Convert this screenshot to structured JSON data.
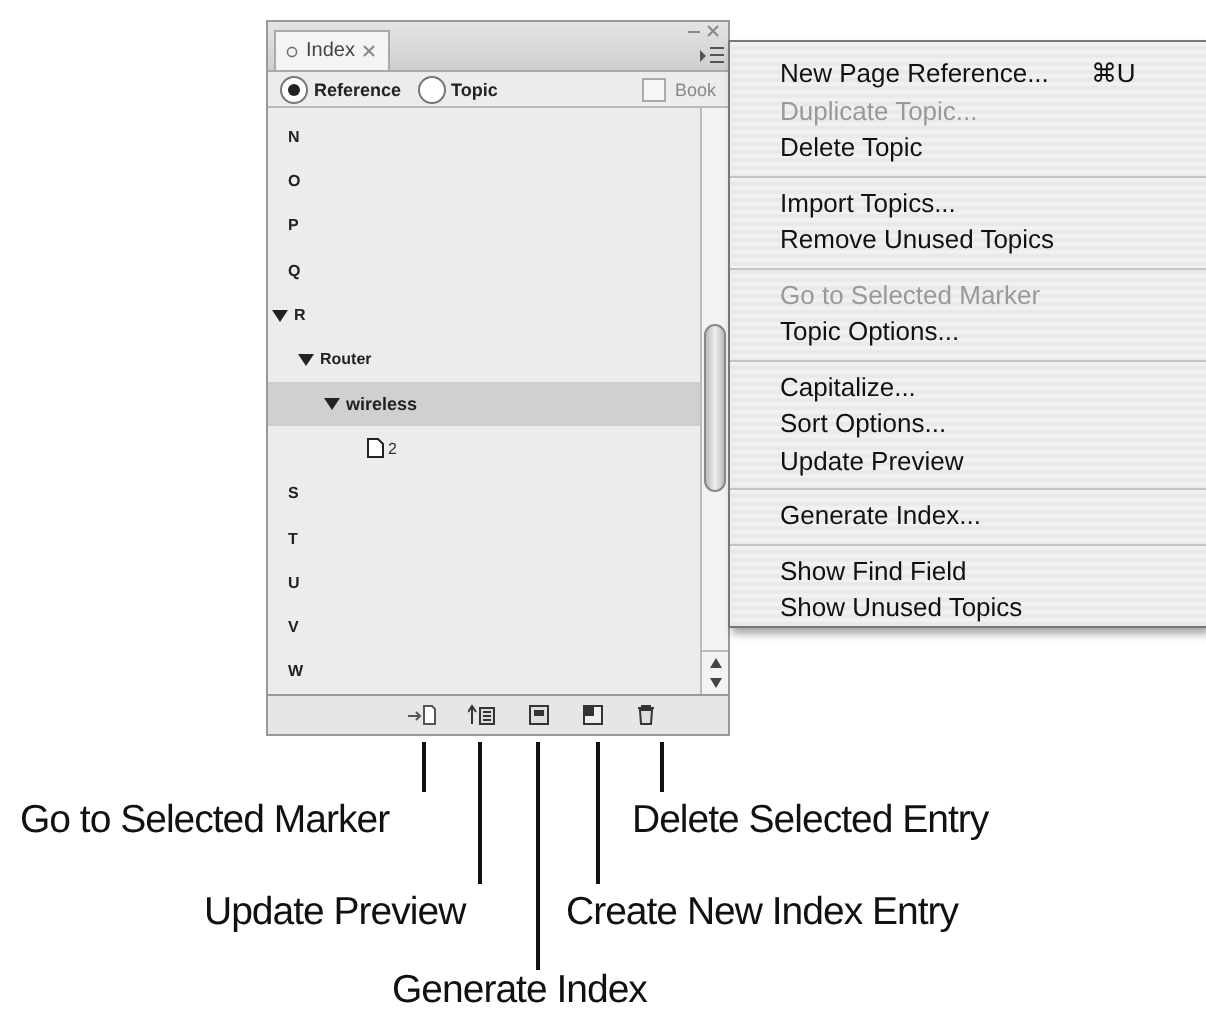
{
  "panel": {
    "tab": {
      "label": "Index"
    },
    "radios": [
      {
        "label": "Reference",
        "selected": true
      },
      {
        "label": "Topic",
        "selected": false
      }
    ],
    "book": {
      "label": "Book",
      "checked": false
    },
    "tree": [
      {
        "label": "N",
        "kind": "topic",
        "selected": false
      },
      {
        "label": "O",
        "kind": "topic",
        "selected": false
      },
      {
        "label": "P",
        "kind": "topic",
        "selected": false
      },
      {
        "label": "Q",
        "kind": "topic",
        "selected": false
      },
      {
        "label": "R",
        "kind": "topic",
        "selected": false,
        "expanded": true,
        "children": [
          {
            "label": "Router",
            "kind": "topic",
            "selected": false,
            "expanded": true,
            "children": [
              {
                "label": "wireless",
                "kind": "topic",
                "selected": true,
                "expanded": true,
                "children": [
                  {
                    "label": "2",
                    "kind": "page",
                    "selected": false
                  }
                ]
              }
            ]
          }
        ]
      },
      {
        "label": "S",
        "kind": "topic",
        "selected": false
      },
      {
        "label": "T",
        "kind": "topic",
        "selected": false
      },
      {
        "label": "U",
        "kind": "topic",
        "selected": false
      },
      {
        "label": "V",
        "kind": "topic",
        "selected": false
      },
      {
        "label": "W",
        "kind": "topic",
        "selected": false
      }
    ]
  },
  "menu": [
    [
      {
        "label": "New Page Reference...",
        "shortcut": "⌘U",
        "disabled": false
      },
      {
        "label": "Duplicate Topic...",
        "disabled": true
      },
      {
        "label": "Delete Topic",
        "disabled": false
      }
    ],
    [
      {
        "label": "Import Topics...",
        "disabled": false
      },
      {
        "label": "Remove Unused Topics",
        "disabled": false
      }
    ],
    [
      {
        "label": "Go to Selected Marker",
        "disabled": true
      },
      {
        "label": "Topic Options...",
        "disabled": false
      }
    ],
    [
      {
        "label": "Capitalize...",
        "disabled": false
      },
      {
        "label": "Sort Options...",
        "disabled": false
      },
      {
        "label": "Update Preview",
        "disabled": false
      }
    ],
    [
      {
        "label": "Generate Index...",
        "disabled": false
      }
    ],
    [
      {
        "label": "Show Find Field",
        "disabled": false
      },
      {
        "label": "Show Unused Topics",
        "disabled": false
      }
    ]
  ],
  "callouts": [
    {
      "label": "Go to Selected Marker"
    },
    {
      "label": "Delete Selected Entry"
    },
    {
      "label": "Update Preview"
    },
    {
      "label": "Create New Index Entry"
    },
    {
      "label": "Generate Index"
    }
  ]
}
